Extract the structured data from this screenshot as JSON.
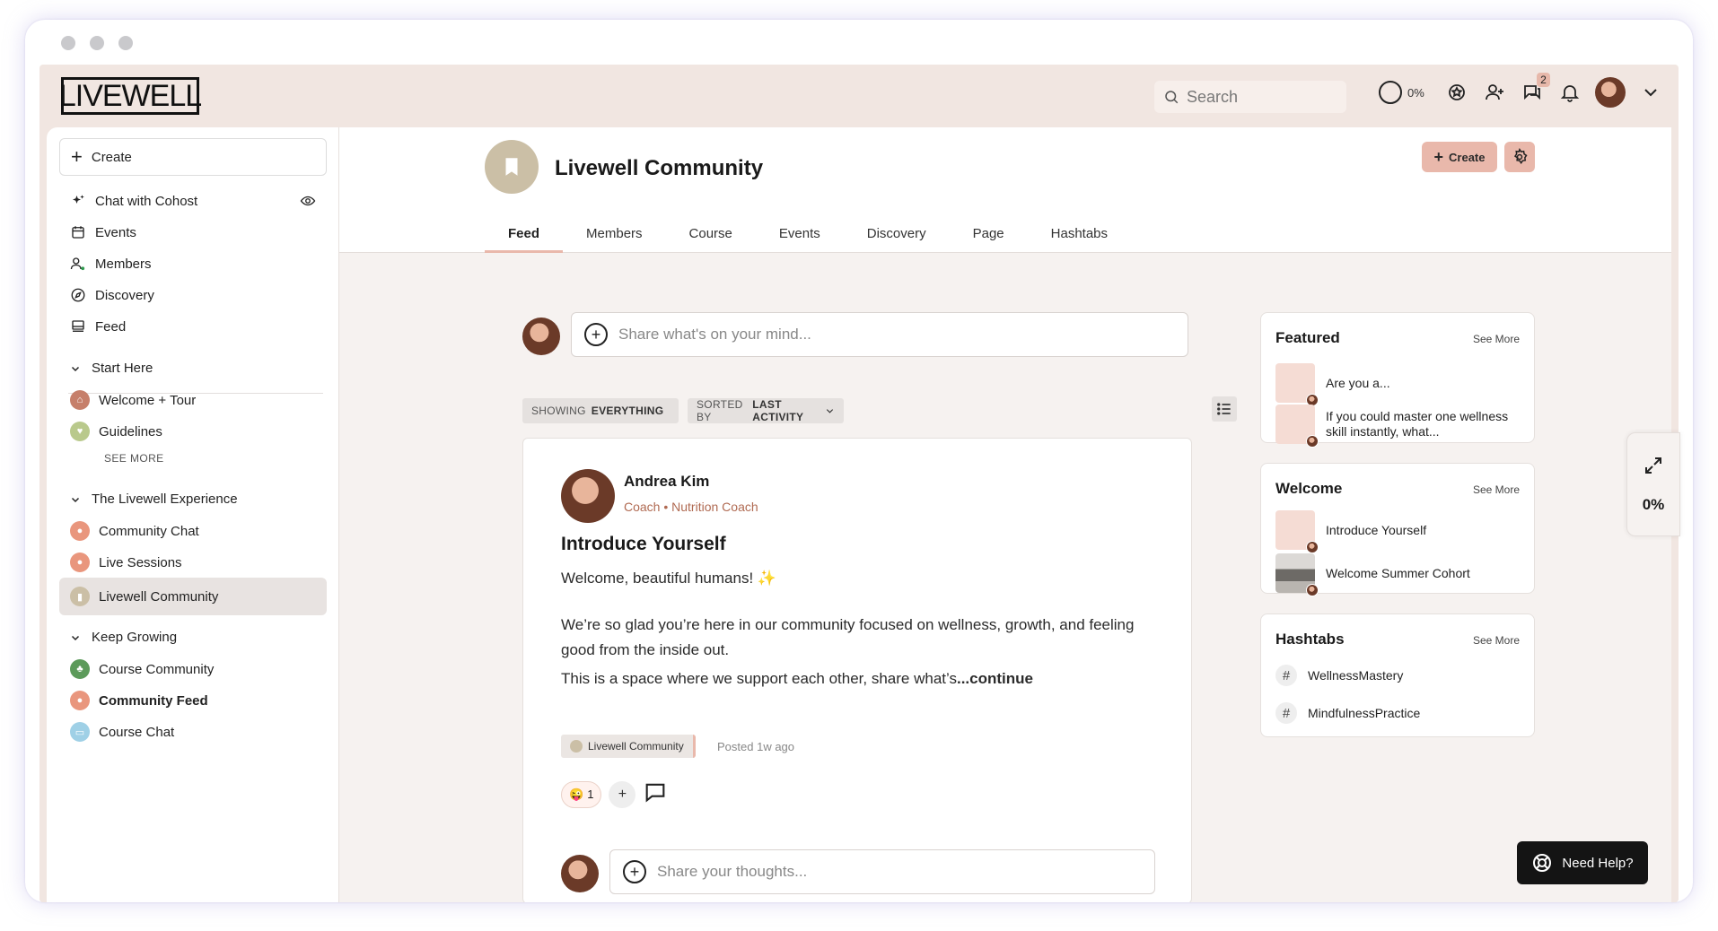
{
  "brand": {
    "logo_text": "LIVEWELL"
  },
  "topbar": {
    "search_placeholder": "Search",
    "progress_label": "0%",
    "messages_badge": "2"
  },
  "sidebar": {
    "create_label": "Create",
    "items": [
      {
        "label": "Chat with Cohost",
        "icon": "sparkle-icon"
      },
      {
        "label": "Events",
        "icon": "calendar-icon"
      },
      {
        "label": "Members",
        "icon": "members-icon"
      },
      {
        "label": "Discovery",
        "icon": "compass-icon"
      },
      {
        "label": "Feed",
        "icon": "feed-icon"
      }
    ],
    "sections": [
      {
        "title": "Start Here",
        "items": [
          {
            "label": "Welcome + Tour",
            "color": "#c67f6a"
          },
          {
            "label": "Guidelines",
            "color": "#b9c98c"
          }
        ],
        "see_more": "SEE MORE"
      },
      {
        "title": "The Livewell Experience",
        "items": [
          {
            "label": "Community Chat",
            "color": "#e9967d"
          },
          {
            "label": "Live Sessions",
            "color": "#e9967d"
          },
          {
            "label": "Livewell Community",
            "color": "#cbbfa6"
          }
        ]
      },
      {
        "title": "Keep Growing",
        "items": [
          {
            "label": "Course Community",
            "color": "#5c9a5a"
          },
          {
            "label": "Community Feed",
            "color": "#e9967d"
          },
          {
            "label": "Course Chat",
            "color": "#9fd0e6"
          }
        ]
      }
    ]
  },
  "space": {
    "title": "Livewell Community",
    "create_label": "Create",
    "tabs": [
      "Feed",
      "Members",
      "Course",
      "Events",
      "Discovery",
      "Page",
      "Hashtabs"
    ]
  },
  "composer": {
    "placeholder": "Share what's on your mind..."
  },
  "filters": {
    "showing_prefix": "SHOWING",
    "showing_value": "EVERYTHING",
    "sorted_prefix": "SORTED BY",
    "sorted_value": "LAST ACTIVITY"
  },
  "post": {
    "author": "Andrea Kim",
    "role": "Coach • Nutrition Coach",
    "title": "Introduce Yourself",
    "greeting": "Welcome, beautiful humans!",
    "sparkle": "✨",
    "paragraph1": "We’re so glad you’re here in our community focused on wellness, growth, and feeling good from the inside out.",
    "paragraph2": "This is a space where we support each other, share what’s",
    "continue": "...continue",
    "space_tag": "Livewell Community",
    "posted": "Posted 1w ago",
    "reaction_emoji": "😜",
    "reaction_count": "1",
    "reply_placeholder": "Share your thoughts..."
  },
  "widgets": {
    "featured": {
      "title": "Featured",
      "see_more": "See More",
      "items": [
        "Are you a...",
        "If you could master one wellness skill instantly, what..."
      ]
    },
    "welcome": {
      "title": "Welcome",
      "see_more": "See More",
      "items": [
        "Introduce Yourself",
        "Welcome Summer Cohort"
      ]
    },
    "hashtabs": {
      "title": "Hashtabs",
      "see_more": "See More",
      "items": [
        "WellnessMastery",
        "MindfulnessPractice"
      ]
    }
  },
  "progress_panel": {
    "label": "0%"
  },
  "help": {
    "label": "Need Help?"
  }
}
